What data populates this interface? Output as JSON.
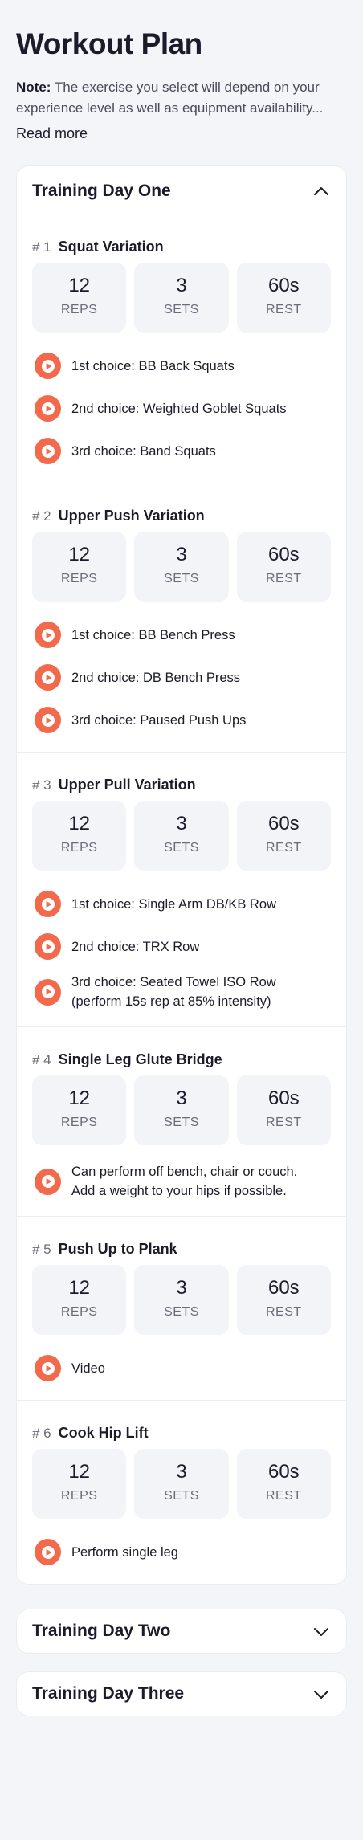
{
  "page": {
    "title": "Workout Plan",
    "note_label": "Note:",
    "note_text": " The exercise you select will depend on your experience level as well as equipment availability...",
    "read_more": "Read more"
  },
  "colors": {
    "accent": "#f26a4b",
    "background": "#f4f5f9",
    "card": "#ffffff",
    "stat_bg": "#f3f4f8"
  },
  "days": [
    {
      "title": "Training Day One",
      "expanded": true,
      "chevron": "chevron-up-icon",
      "exercises": [
        {
          "num": "# 1",
          "name": "Squat Variation",
          "stats": [
            {
              "value": "12",
              "label": "REPS"
            },
            {
              "value": "3",
              "label": "SETS"
            },
            {
              "value": "60s",
              "label": "REST"
            }
          ],
          "choices": [
            "1st choice: BB Back Squats",
            "2nd choice: Weighted Goblet Squats",
            "3rd choice: Band Squats"
          ]
        },
        {
          "num": "# 2",
          "name": "Upper Push Variation",
          "stats": [
            {
              "value": "12",
              "label": "REPS"
            },
            {
              "value": "3",
              "label": "SETS"
            },
            {
              "value": "60s",
              "label": "REST"
            }
          ],
          "choices": [
            "1st choice: BB Bench Press",
            "2nd choice: DB Bench Press",
            "3rd choice: Paused Push Ups"
          ]
        },
        {
          "num": "# 3",
          "name": "Upper Pull Variation",
          "stats": [
            {
              "value": "12",
              "label": "REPS"
            },
            {
              "value": "3",
              "label": "SETS"
            },
            {
              "value": "60s",
              "label": "REST"
            }
          ],
          "choices": [
            "1st choice: Single Arm DB/KB Row",
            "2nd choice: TRX Row",
            "3rd choice: Seated Towel ISO Row\n(perform 15s rep at 85% intensity)"
          ]
        },
        {
          "num": "# 4",
          "name": "Single Leg Glute Bridge",
          "stats": [
            {
              "value": "12",
              "label": "REPS"
            },
            {
              "value": "3",
              "label": "SETS"
            },
            {
              "value": "60s",
              "label": "REST"
            }
          ],
          "choices": [
            "Can perform off bench, chair or couch.\nAdd a weight to your hips if possible."
          ]
        },
        {
          "num": "# 5",
          "name": "Push Up to Plank",
          "stats": [
            {
              "value": "12",
              "label": "REPS"
            },
            {
              "value": "3",
              "label": "SETS"
            },
            {
              "value": "60s",
              "label": "REST"
            }
          ],
          "choices": [
            "Video"
          ]
        },
        {
          "num": "# 6",
          "name": "Cook Hip Lift",
          "stats": [
            {
              "value": "12",
              "label": "REPS"
            },
            {
              "value": "3",
              "label": "SETS"
            },
            {
              "value": "60s",
              "label": "REST"
            }
          ],
          "choices": [
            "Perform single leg"
          ]
        }
      ]
    },
    {
      "title": "Training Day Two",
      "expanded": false,
      "chevron": "chevron-down-icon"
    },
    {
      "title": "Training Day Three",
      "expanded": false,
      "chevron": "chevron-down-icon"
    }
  ]
}
